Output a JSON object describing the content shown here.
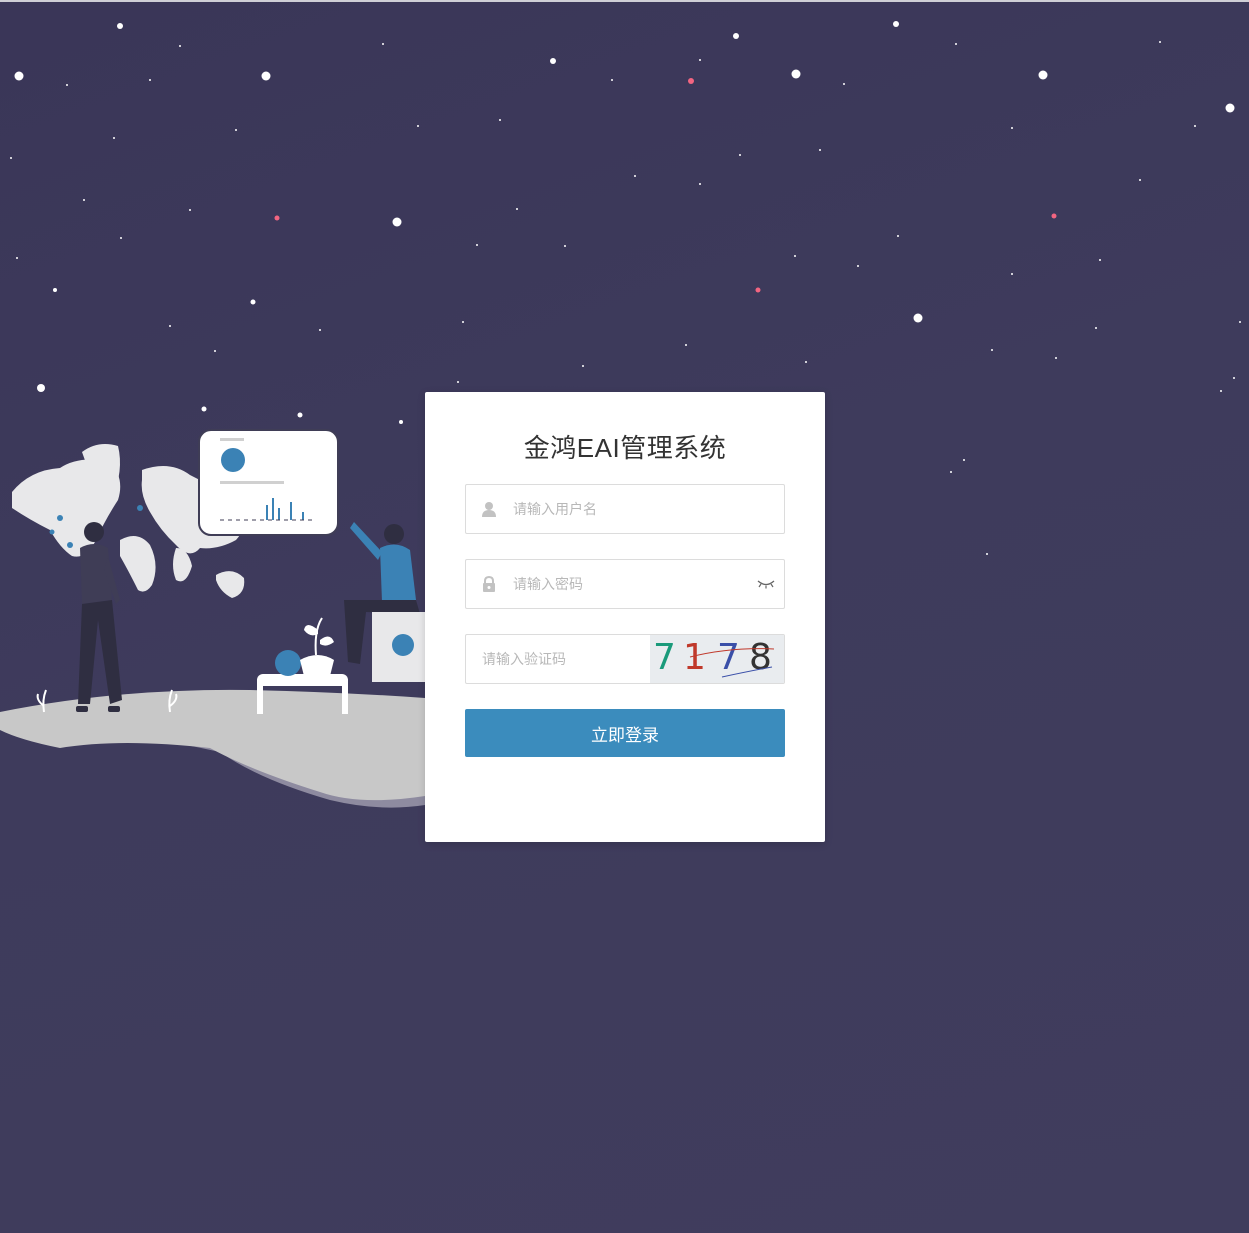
{
  "app": {
    "title": "金鸿EAI管理系统"
  },
  "login": {
    "username_placeholder": "请输入用户名",
    "password_placeholder": "请输入密码",
    "captcha_placeholder": "请输入验证码",
    "captcha_digits": [
      "7",
      "1",
      "7",
      "8"
    ],
    "submit_label": "立即登录"
  },
  "icons": {
    "username": "user-icon",
    "password": "lock-icon",
    "toggle_password": "eye-closed-icon"
  },
  "colors": {
    "background": "#3e3b5c",
    "card": "#ffffff",
    "button": "#3b8cbd",
    "accent_blue": "#3b82b5",
    "star_red": "#f36581",
    "ground": "#c8c8c8"
  }
}
